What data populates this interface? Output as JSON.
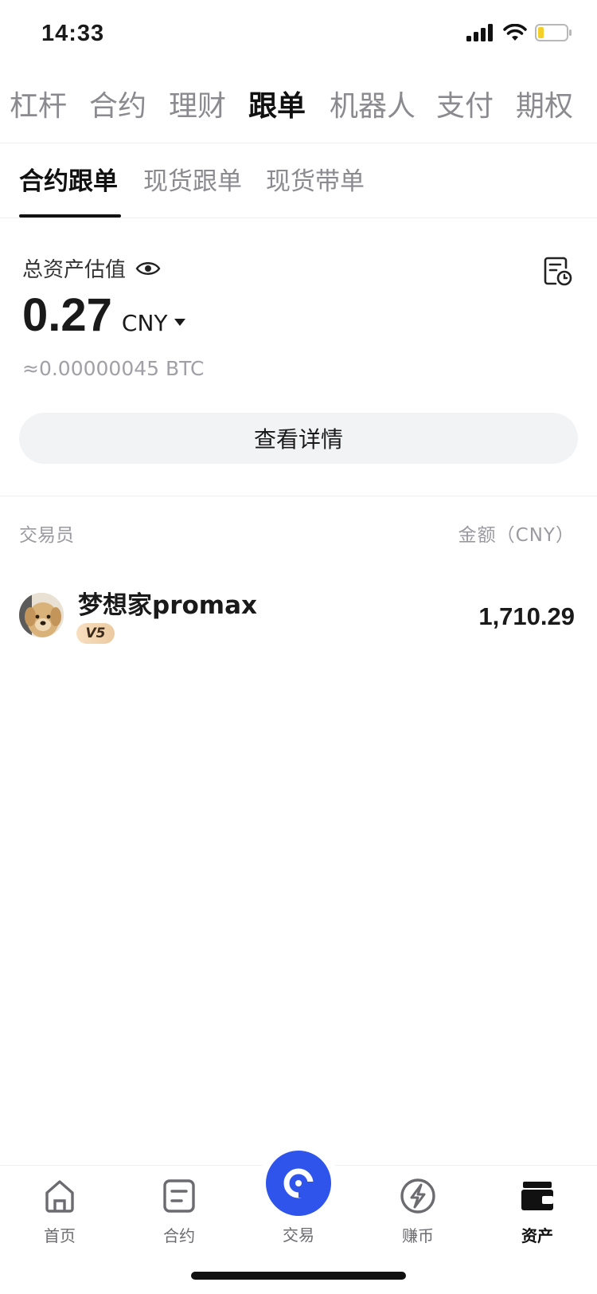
{
  "status_bar": {
    "time": "14:33"
  },
  "category_tabs": [
    {
      "label": "杠杆",
      "active": false
    },
    {
      "label": "合约",
      "active": false
    },
    {
      "label": "理财",
      "active": false
    },
    {
      "label": "跟单",
      "active": true
    },
    {
      "label": "机器人",
      "active": false
    },
    {
      "label": "支付",
      "active": false
    },
    {
      "label": "期权",
      "active": false
    }
  ],
  "sub_tabs": [
    {
      "label": "合约跟单",
      "active": true
    },
    {
      "label": "现货跟单",
      "active": false
    },
    {
      "label": "现货带单",
      "active": false
    }
  ],
  "assets": {
    "label": "总资产估值",
    "value": "0.27",
    "currency": "CNY",
    "btc_equivalent": "≈0.00000045  BTC",
    "details_button": "查看详情"
  },
  "list": {
    "header_left": "交易员",
    "header_right": "金额（CNY）",
    "rows": [
      {
        "name": "梦想家promax",
        "badge": "V5",
        "amount": "1,710.29"
      }
    ]
  },
  "bottom_nav": [
    {
      "label": "首页",
      "icon": "home-icon",
      "active": false
    },
    {
      "label": "合约",
      "icon": "contract-icon",
      "active": false
    },
    {
      "label": "交易",
      "icon": "trade-icon",
      "active": false
    },
    {
      "label": "赚币",
      "icon": "earn-icon",
      "active": false
    },
    {
      "label": "资产",
      "icon": "wallet-icon",
      "active": true
    }
  ],
  "colors": {
    "accent": "#2f54eb",
    "text_primary": "#1a1a1a",
    "text_secondary": "#8a8a8f",
    "button_bg": "#f2f3f5",
    "badge_gold": "#eccaa0"
  }
}
